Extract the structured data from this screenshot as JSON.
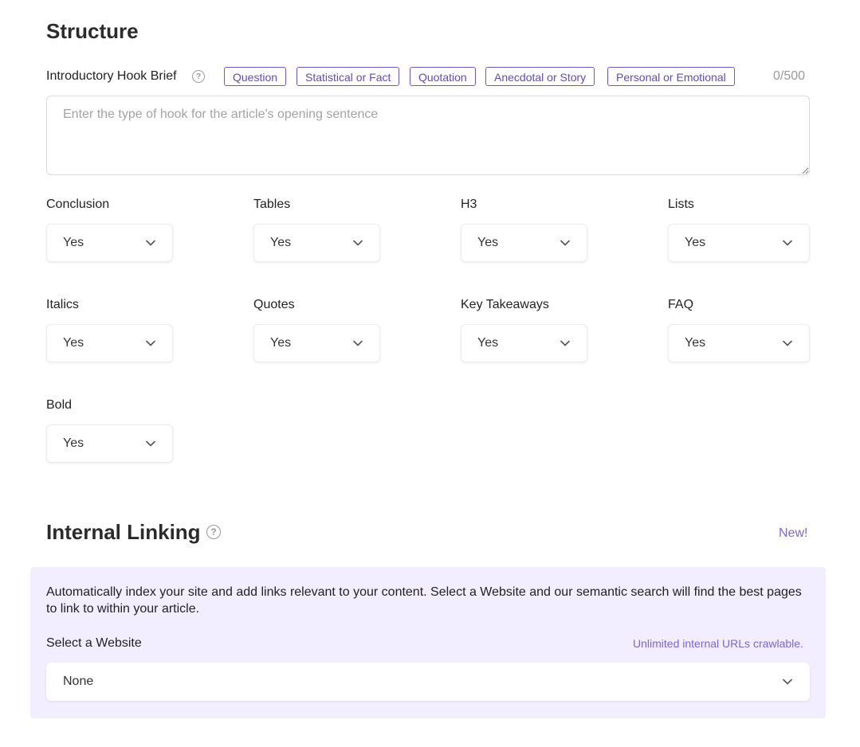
{
  "structure": {
    "title": "Structure",
    "hook": {
      "label": "Introductory Hook Brief",
      "chips": [
        "Question",
        "Statistical or Fact",
        "Quotation",
        "Anecdotal or Story",
        "Personal or Emotional"
      ],
      "counter": "0/500",
      "placeholder": "Enter the type of hook for the article's opening sentence",
      "value": ""
    },
    "options": [
      {
        "label": "Conclusion",
        "value": "Yes"
      },
      {
        "label": "Tables",
        "value": "Yes"
      },
      {
        "label": "H3",
        "value": "Yes"
      },
      {
        "label": "Lists",
        "value": "Yes"
      },
      {
        "label": "Italics",
        "value": "Yes"
      },
      {
        "label": "Quotes",
        "value": "Yes"
      },
      {
        "label": "Key Takeaways",
        "value": "Yes"
      },
      {
        "label": "FAQ",
        "value": "Yes"
      },
      {
        "label": "Bold",
        "value": "Yes"
      }
    ]
  },
  "internal_linking": {
    "title": "Internal Linking",
    "new_label": "New!",
    "description": "Automatically index your site and add links relevant to your content. Select a Website and our semantic search will find the best pages to link to within your article.",
    "select_label": "Select a Website",
    "unlimited_note": "Unlimited internal URLs crawlable.",
    "website_value": "None"
  },
  "icons": {
    "help": "help-circle-icon",
    "chevron": "chevron-down-icon"
  },
  "colors": {
    "accent": "#6b5bd6",
    "panel_bg": "#f2edff"
  }
}
